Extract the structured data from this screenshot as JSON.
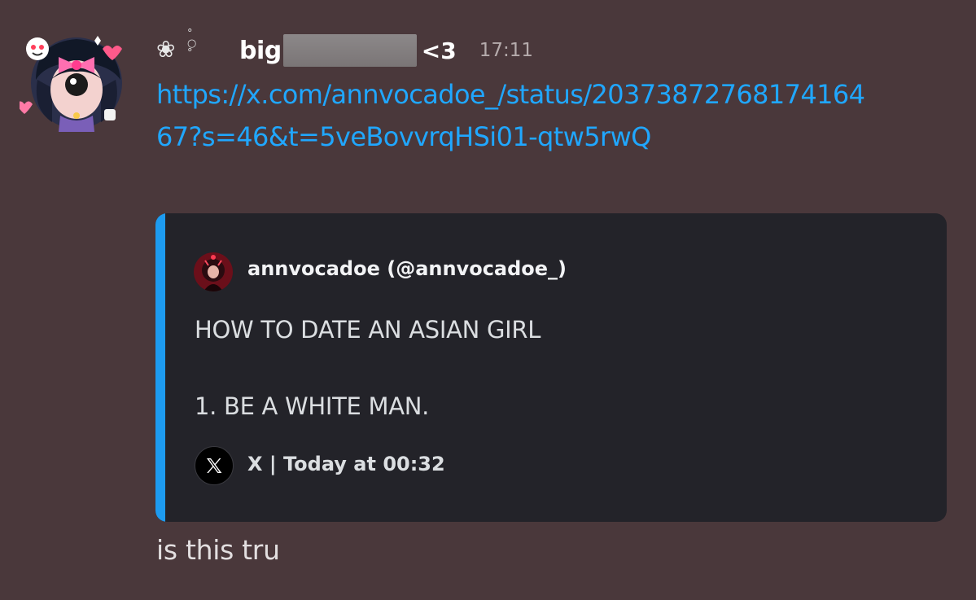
{
  "message": {
    "author": {
      "decoration": "❀",
      "decoration_dots": "°\n○\n°",
      "name_prefix": "big",
      "name_suffix": "<3",
      "avatar_icon": "anime-girl-avatar"
    },
    "timestamp": "17:11",
    "link": "https://x.com/annvocadoe_/status/2037387276817416467?s=46&t=5veBovvrqHSi01-qtw5rwQ",
    "text": "is this tru"
  },
  "embed": {
    "accent_color": "#1d9bf0",
    "author": "annvocadoe (@annvocadoe_)",
    "description": "HOW TO DATE AN ASIAN GIRL\n\n1. BE A WHITE MAN.",
    "footer_icon": "x-logo-icon",
    "footer": "X | Today at 00:32"
  },
  "colors": {
    "background": "#4a383b",
    "embed_background": "#232329",
    "link": "#20a7ff"
  }
}
